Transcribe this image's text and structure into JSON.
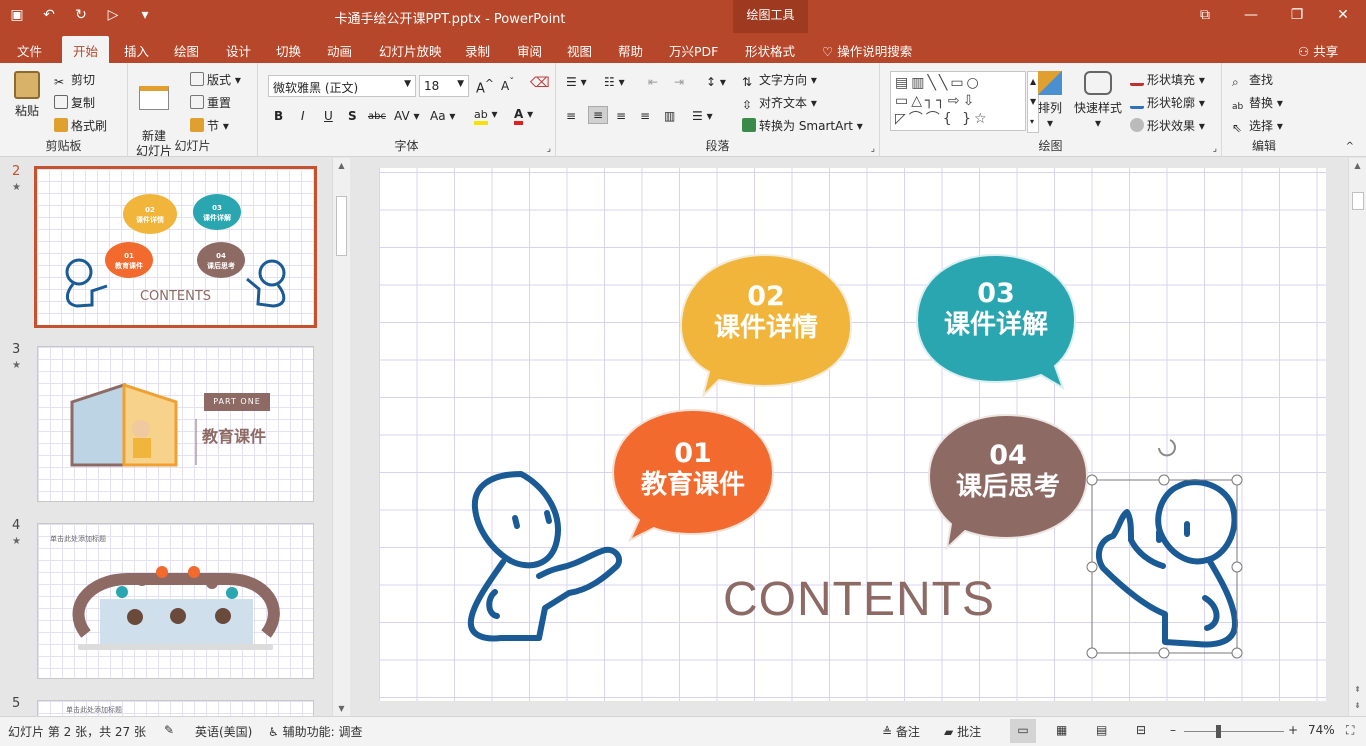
{
  "app": {
    "title": "卡通手绘公开课PPT.pptx  -  PowerPoint",
    "context_tool": "绘图工具",
    "accent": "#b7472a"
  },
  "tabs": [
    "文件",
    "开始",
    "插入",
    "绘图",
    "设计",
    "切换",
    "动画",
    "幻灯片放映",
    "录制",
    "审阅",
    "视图",
    "帮助",
    "万兴PDF",
    "形状格式"
  ],
  "tell_me": "操作说明搜索",
  "share": "共享",
  "ribbon": {
    "clipboard": {
      "label": "剪贴板",
      "paste": "粘贴",
      "cut": "剪切",
      "copy": "复制",
      "format_painter": "格式刷"
    },
    "slides": {
      "label": "幻灯片",
      "new_slide": "新建\n幻灯片",
      "layout": "版式",
      "reset": "重置",
      "section": "节"
    },
    "font": {
      "label": "字体",
      "font_name": "微软雅黑 (正文)",
      "font_size": "18",
      "aa": "Aa"
    },
    "paragraph": {
      "label": "段落",
      "text_direction": "文字方向",
      "align_text": "对齐文本",
      "smartart": "转换为 SmartArt"
    },
    "drawing": {
      "label": "绘图",
      "arrange": "排列",
      "quick_styles": "快速样式",
      "shape_fill": "形状填充",
      "shape_outline": "形状轮廓",
      "shape_effects": "形状效果"
    },
    "editing": {
      "label": "编辑",
      "find": "查找",
      "replace": "替换",
      "select": "选择"
    }
  },
  "thumbnails": [
    {
      "num": "2",
      "star": "★",
      "bubbles": [
        {
          "n": "02",
          "t": "课件详情"
        },
        {
          "n": "03",
          "t": "课件详解"
        },
        {
          "n": "01",
          "t": "教育课件"
        },
        {
          "n": "04",
          "t": "课后思考"
        }
      ],
      "contents": "CONTENTS"
    },
    {
      "num": "3",
      "star": "★",
      "part": "PART ONE",
      "title": "教育课件"
    },
    {
      "num": "4",
      "star": "★",
      "heading": "单击此处添加标题"
    },
    {
      "num": "5",
      "heading": "单击此处添加标题"
    }
  ],
  "slide": {
    "bubbles": [
      {
        "n": "02",
        "t": "课件详情",
        "color": "#f0b53a"
      },
      {
        "n": "03",
        "t": "课件详解",
        "color": "#29a6b0"
      },
      {
        "n": "01",
        "t": "教育课件",
        "color": "#f26a2e"
      },
      {
        "n": "04",
        "t": "课后思考",
        "color": "#8d6a64"
      }
    ],
    "contents": "CONTENTS",
    "figure_color": "#1a5a95"
  },
  "status": {
    "slide_info": "幻灯片 第 2 张，共 27 张",
    "language": "英语(美国)",
    "accessibility": "辅助功能: 调查",
    "notes": "备注",
    "comments": "批注",
    "zoom": "74%"
  }
}
